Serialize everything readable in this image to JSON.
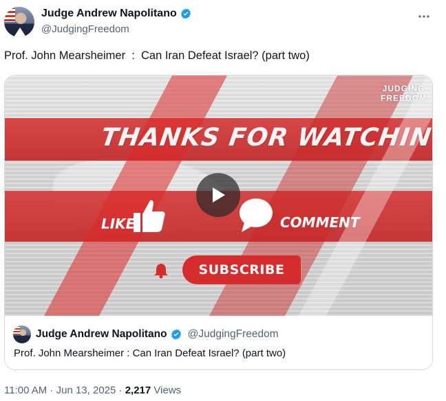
{
  "author": {
    "name": "Judge Andrew Napolitano",
    "handle": "@JudgingFreedom",
    "verified_color": "#1d9bf0"
  },
  "more_icon": "more-horizontal-icon",
  "tweet_text": "Prof. John Mearsheimer  :  Can Iran Defeat Israel? (part two)",
  "video": {
    "brand_line1": "JUDGING",
    "brand_line2": "FREEDOM",
    "headline": "THANKS FOR WATCHING",
    "like_label": "LIKE",
    "comment_label": "COMMENT",
    "subscribe_label": "SUBSCRIBE",
    "accent_color": "#d62c2c"
  },
  "quote": {
    "name": "Judge Andrew Napolitano",
    "handle": "@JudgingFreedom",
    "text": "Prof. John Mearsheimer : Can Iran Defeat Israel? (part two)"
  },
  "meta": {
    "time": "11:00 AM",
    "sep1": " · ",
    "date": "Jun 13, 2025",
    "sep2": " · ",
    "views_count": "2,217",
    "views_label": " Views"
  }
}
